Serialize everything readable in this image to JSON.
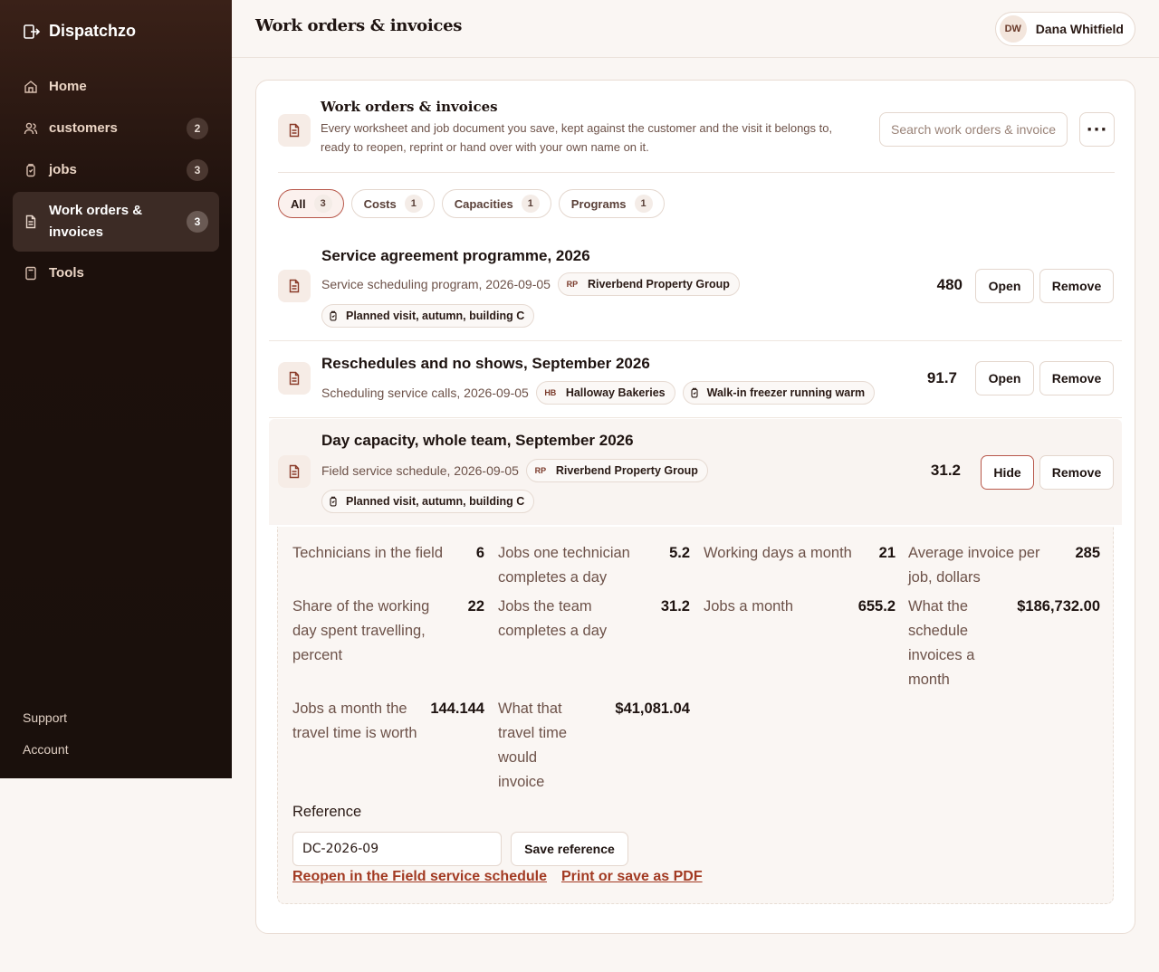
{
  "app": {
    "name": "Dispatchzo"
  },
  "sidebar": {
    "items": [
      {
        "label": "Home",
        "count": ""
      },
      {
        "label": "customers",
        "count": "2"
      },
      {
        "label": "jobs",
        "count": "3"
      },
      {
        "label": "Work orders & invoices",
        "count": "3"
      },
      {
        "label": "Tools",
        "count": ""
      }
    ],
    "bottom": {
      "support": "Support",
      "account": "Account"
    }
  },
  "header": {
    "title": "Work orders & invoices",
    "user": {
      "initials": "DW",
      "name": "Dana Whitfield"
    }
  },
  "card": {
    "title": "Work orders & invoices",
    "description": "Every worksheet and job document you save, kept against the customer and the visit it belongs to, ready to reopen, reprint or hand over with your own name on it.",
    "search_placeholder": "Search work orders & invoices",
    "more_label": "···"
  },
  "filters": [
    {
      "label": "All",
      "count": "3"
    },
    {
      "label": "Costs",
      "count": "1"
    },
    {
      "label": "Capacities",
      "count": "1"
    },
    {
      "label": "Programs",
      "count": "1"
    }
  ],
  "rows": [
    {
      "title": "Service agreement programme, 2026",
      "meta": "Service scheduling program, 2026-09-05",
      "customer_initials": "RP",
      "customer": "Riverbend Property Group",
      "job": "Planned visit, autumn, building C",
      "value": "480",
      "primary": "Open",
      "secondary": "Remove"
    },
    {
      "title": "Reschedules and no shows, September 2026",
      "meta": "Scheduling service calls, 2026-09-05",
      "customer_initials": "HB",
      "customer": "Halloway Bakeries",
      "job": "Walk-in freezer running warm",
      "value": "91.7",
      "primary": "Open",
      "secondary": "Remove"
    },
    {
      "title": "Day capacity, whole team, September 2026",
      "meta": "Field service schedule, 2026-09-05",
      "customer_initials": "RP",
      "customer": "Riverbend Property Group",
      "job": "Planned visit, autumn, building C",
      "value": "31.2",
      "primary": "Hide",
      "secondary": "Remove"
    }
  ],
  "details": {
    "metrics": [
      {
        "label": "Technicians in the field",
        "value": "6"
      },
      {
        "label": "Jobs one technician completes a day",
        "value": "5.2"
      },
      {
        "label": "Working days a month",
        "value": "21"
      },
      {
        "label": "Average invoice per job, dollars",
        "value": "285"
      },
      {
        "label": "Share of the working day spent travelling, percent",
        "value": "22"
      },
      {
        "label": "Jobs the team completes a day",
        "value": "31.2"
      },
      {
        "label": "Jobs a month",
        "value": "655.2"
      },
      {
        "label": "What the schedule invoices a month",
        "value": "$186,732.00"
      },
      {
        "label": "Jobs a month the travel time is worth",
        "value": "144.144"
      },
      {
        "label": "What that travel time would invoice",
        "value": "$41,081.04"
      }
    ],
    "reference_label": "Reference",
    "reference_value": "DC-2026-09",
    "save_reference": "Save reference",
    "link_reopen": "Reopen in the Field service schedule",
    "link_print": "Print or save as PDF"
  },
  "colors": {
    "accent": "#a23a22",
    "sidebar": "#1c100c"
  }
}
